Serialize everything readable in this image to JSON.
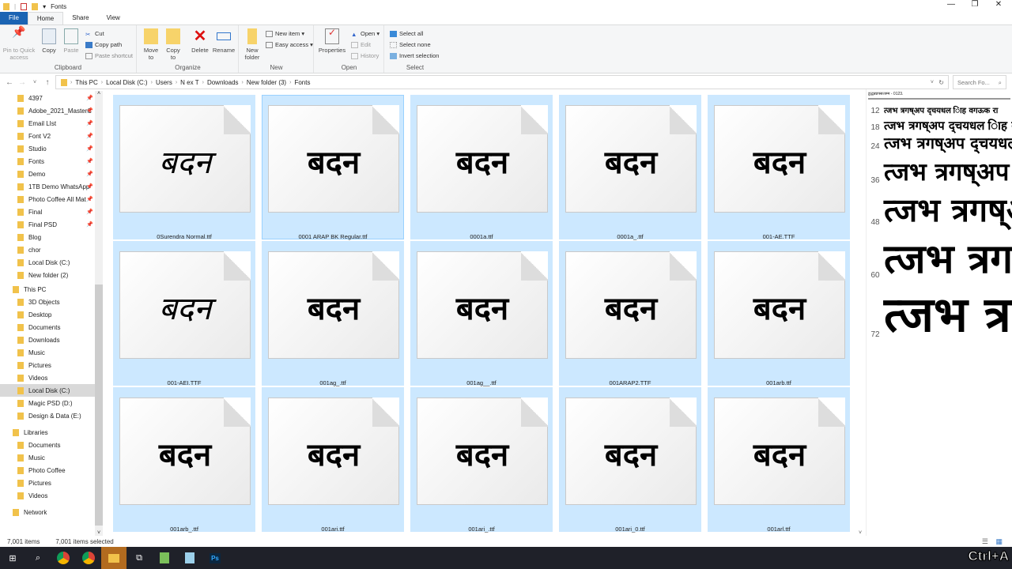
{
  "window": {
    "title": "Fonts",
    "minimize": "—",
    "maximize": "❐",
    "close": "✕"
  },
  "tabs": [
    "File",
    "Home",
    "Share",
    "View"
  ],
  "ribbon": {
    "clipboard": {
      "label": "Clipboard",
      "pin": "Pin to Quick access",
      "copy": "Copy",
      "paste": "Paste",
      "cut": "Cut",
      "copy_path": "Copy path",
      "paste_shortcut": "Paste shortcut"
    },
    "organize": {
      "label": "Organize",
      "move_to": "Move to",
      "copy_to": "Copy to",
      "delete": "Delete",
      "rename": "Rename"
    },
    "new": {
      "label": "New",
      "new_folder": "New folder",
      "new_item": "New item ▾",
      "easy_access": "Easy access ▾"
    },
    "open": {
      "label": "Open",
      "properties": "Properties",
      "open": "Open ▾",
      "edit": "Edit",
      "history": "History"
    },
    "select": {
      "label": "Select",
      "select_all": "Select all",
      "select_none": "Select none",
      "invert": "Invert selection"
    }
  },
  "address": {
    "path": [
      "This PC",
      "Local Disk (C:)",
      "Users",
      "N ex T",
      "Downloads",
      "New folder (3)",
      "Fonts"
    ],
    "search_placeholder": "Search Fo..."
  },
  "sidebar": {
    "quick": [
      "4397",
      "Adobe_2021_MasterC",
      "Email LIst",
      "Font V2",
      "Studio",
      "Fonts",
      "Demo",
      "1TB Demo WhatsApp",
      "Photo Coffee All Mat",
      "Final",
      "Final PSD",
      "Blog",
      "chor",
      "Local Disk (C:)",
      "New folder (2)"
    ],
    "this_pc": "This PC",
    "pc_items": [
      "3D Objects",
      "Desktop",
      "Documents",
      "Downloads",
      "Music",
      "Pictures",
      "Videos",
      "Local Disk (C:)",
      "Magic PSD (D:)",
      "Design & Data (E:)"
    ],
    "libraries": "Libraries",
    "lib_items": [
      "Documents",
      "Music",
      "Photo Coffee",
      "Pictures",
      "Videos"
    ],
    "network": "Network"
  },
  "files": [
    {
      "name": "0Surendra Normal.ttf",
      "sample": "बदन"
    },
    {
      "name": "0001 ARAP  BK Regular.ttf",
      "sample": "बदन"
    },
    {
      "name": "0001a.ttf",
      "sample": "बदन"
    },
    {
      "name": "0001a_.ttf",
      "sample": "बदन"
    },
    {
      "name": "001-AE.TTF",
      "sample": "बदन"
    },
    {
      "name": "001-AEI.TTF",
      "sample": "बदन"
    },
    {
      "name": "001ag_.ttf",
      "sample": "बदन"
    },
    {
      "name": "001ag__.ttf",
      "sample": "बदन"
    },
    {
      "name": "001ARAP2.TTF",
      "sample": "बदन"
    },
    {
      "name": "001arb.ttf",
      "sample": "बदन"
    },
    {
      "name": "001arb_.ttf",
      "sample": "बदन"
    },
    {
      "name": "001ari.ttf",
      "sample": "बदन"
    },
    {
      "name": "001ari_.ttf",
      "sample": "बदन"
    },
    {
      "name": "001ari_0.ttf",
      "sample": "बदन"
    },
    {
      "name": "001arl.ttf",
      "sample": "बदन"
    }
  ],
  "preview": {
    "header": "ड्डद्धन्नप्रफ्सत्त्रम्म - 0123.",
    "sample": "त्जभ त्रगष्अप द्चयधल ािह वगऊक रा",
    "sizes": [
      "12",
      "18",
      "24",
      "36",
      "48",
      "60",
      "72"
    ]
  },
  "status": {
    "items": "7,001 items",
    "selected": "7,001 items selected"
  },
  "taskbar": {
    "ps": "Ps"
  },
  "overlay": "Ctrl+A"
}
